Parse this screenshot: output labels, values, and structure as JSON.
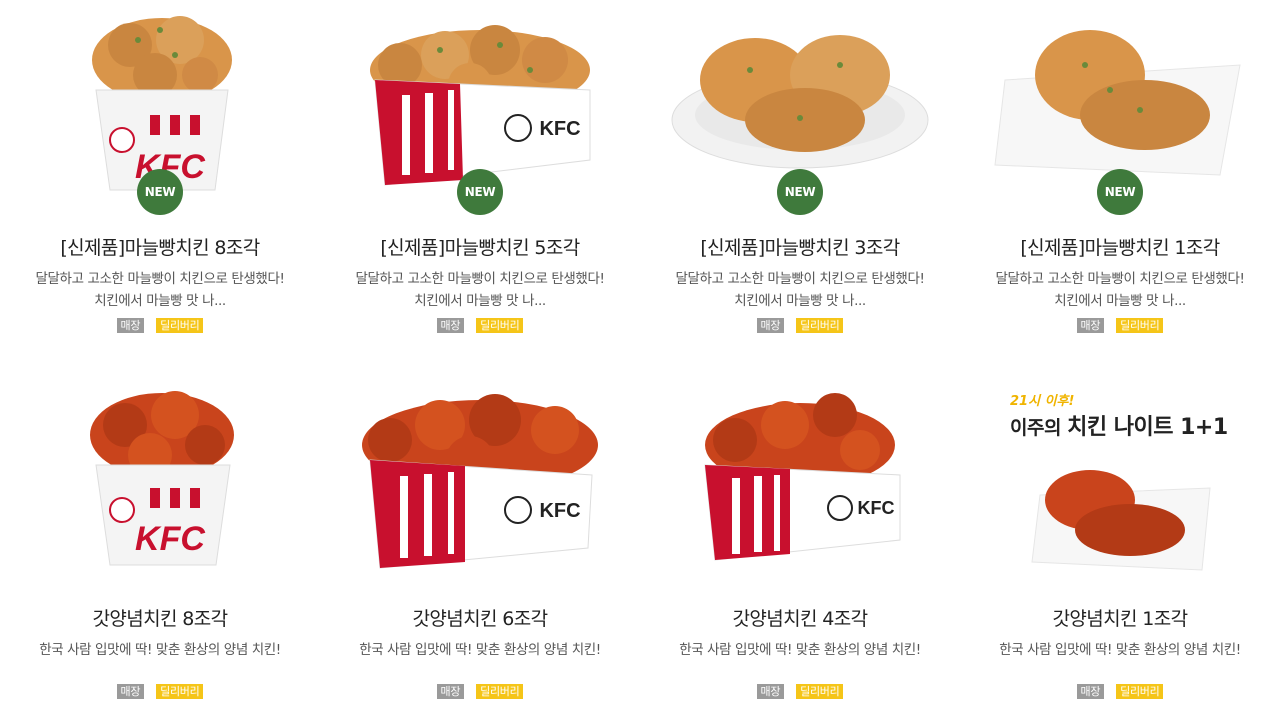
{
  "tags": {
    "store": "매장",
    "delivery": "딜리버리"
  },
  "new_label": "NEW",
  "products": [
    {
      "title": "[신제품]마늘빵치킨 8조각",
      "desc1": "달달하고 고소한 마늘빵이 치킨으로 탄생했다!",
      "desc2": "치킨에서 마늘빵 맛 나...",
      "is_new": true,
      "image": "bucket"
    },
    {
      "title": "[신제품]마늘빵치킨 5조각",
      "desc1": "달달하고 고소한 마늘빵이 치킨으로 탄생했다!",
      "desc2": "치킨에서 마늘빵 맛 나...",
      "is_new": true,
      "image": "box"
    },
    {
      "title": "[신제품]마늘빵치킨 3조각",
      "desc1": "달달하고 고소한 마늘빵이 치킨으로 탄생했다!",
      "desc2": "치킨에서 마늘빵 맛 나...",
      "is_new": true,
      "image": "plate"
    },
    {
      "title": "[신제품]마늘빵치킨 1조각",
      "desc1": "달달하고 고소한 마늘빵이 치킨으로 탄생했다!",
      "desc2": "치킨에서 마늘빵 맛 나...",
      "is_new": true,
      "image": "paper"
    },
    {
      "title": "갓양념치킨 8조각",
      "desc1": "한국 사람 입맛에 딱! 맞춘 환상의 양념 치킨!",
      "is_new": false,
      "image": "bucket"
    },
    {
      "title": "갓양념치킨 6조각",
      "desc1": "한국 사람 입맛에 딱! 맞춘 환상의 양념 치킨!",
      "is_new": false,
      "image": "box"
    },
    {
      "title": "갓양념치킨 4조각",
      "desc1": "한국 사람 입맛에 딱! 맞춘 환상의 양념 치킨!",
      "is_new": false,
      "image": "box"
    },
    {
      "title": "갓양념치킨 1조각",
      "desc1": "한국 사람 입맛에 딱! 맞춘 환상의 양념 치킨!",
      "is_new": false,
      "image": "paper"
    }
  ],
  "promo": {
    "line1": "21시 이후!",
    "line2_prefix": "이주의",
    "line2_main": "치킨 나이트 1+1"
  },
  "brand": "KFC",
  "colors": {
    "kfc_red": "#c8102e",
    "new_badge": "#3f7a3c",
    "tag_store": "#9a9a9a",
    "tag_delivery": "#f5c518",
    "garlic_chicken": "#d9954a",
    "yangnyeom_chicken": "#c9441c"
  }
}
